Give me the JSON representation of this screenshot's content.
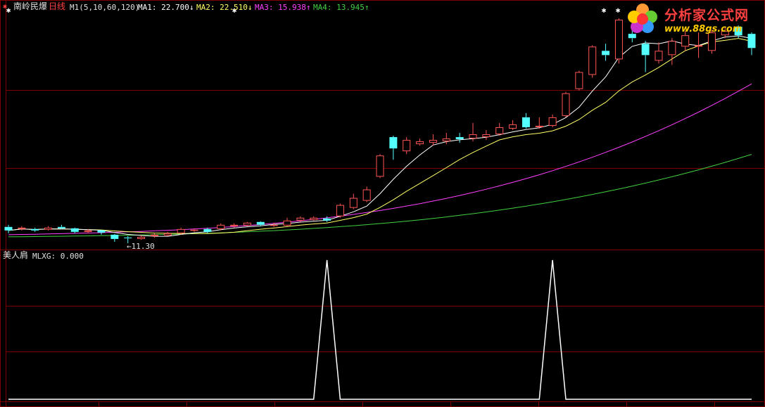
{
  "header": {
    "stock_name": "南岭民爆",
    "period": "日线",
    "indicator_params": "M1(5,10,60,120)",
    "ma1": "MA1: 22.700↓",
    "ma2": "MA2: 22.510↓",
    "ma3": "MA3: 15.938↑",
    "ma4": "MA4: 13.945↑"
  },
  "sub_panel": {
    "name": "美人肩",
    "value": "MLXG: 0.000"
  },
  "annotation_low": "←11.30",
  "watermark": {
    "title": "分析家公式网",
    "url": "www.88gs.com"
  },
  "colors": {
    "background": "#000000",
    "grid": "#800000",
    "up_candle": "#ff5555",
    "down_candle": "#54ffff",
    "ma1": "#ffffff",
    "ma2": "#ffff66",
    "ma3": "#ff40ff",
    "ma4": "#40d040",
    "signal": "#ffffff"
  },
  "chart_data": [
    {
      "type": "candlestick",
      "title": "南岭民爆 日线",
      "ylim": [
        11,
        27.5
      ],
      "candles": [
        [
          12.45,
          12.2,
          12.6,
          12.0
        ],
        [
          12.3,
          12.4,
          12.5,
          12.2
        ],
        [
          12.3,
          12.2,
          12.4,
          12.1
        ],
        [
          12.25,
          12.4,
          12.5,
          12.2
        ],
        [
          12.45,
          12.35,
          12.6,
          12.3
        ],
        [
          12.35,
          12.1,
          12.4,
          12.0
        ],
        [
          12.1,
          12.2,
          12.3,
          12.0
        ],
        [
          12.2,
          12.05,
          12.25,
          11.9
        ],
        [
          11.9,
          11.6,
          11.95,
          11.4
        ],
        [
          11.7,
          11.65,
          11.8,
          11.3
        ],
        [
          11.6,
          11.75,
          11.85,
          11.55
        ],
        [
          11.8,
          11.9,
          12.0,
          11.7
        ],
        [
          11.85,
          12.0,
          12.1,
          11.8
        ],
        [
          12.0,
          12.3,
          12.4,
          11.9
        ],
        [
          12.2,
          12.25,
          12.35,
          12.1
        ],
        [
          12.3,
          12.1,
          12.4,
          12.0
        ],
        [
          12.3,
          12.6,
          12.7,
          12.2
        ],
        [
          12.5,
          12.6,
          12.7,
          12.4
        ],
        [
          12.55,
          12.75,
          12.8,
          12.5
        ],
        [
          12.8,
          12.6,
          12.85,
          12.5
        ],
        [
          12.55,
          12.6,
          12.75,
          12.45
        ],
        [
          12.55,
          12.9,
          13.1,
          12.5
        ],
        [
          12.9,
          13.1,
          13.2,
          12.8
        ],
        [
          12.95,
          13.1,
          13.2,
          12.9
        ],
        [
          13.05,
          12.9,
          13.2,
          12.8
        ],
        [
          13.2,
          14.0,
          14.1,
          13.1
        ],
        [
          13.8,
          14.5,
          14.8,
          13.7
        ],
        [
          14.3,
          15.1,
          15.3,
          14.2
        ],
        [
          16.0,
          17.5,
          17.6,
          15.9
        ],
        [
          18.8,
          18.0,
          18.9,
          17.2
        ],
        [
          17.8,
          18.6,
          18.8,
          17.6
        ],
        [
          18.3,
          18.5,
          18.7,
          18.2
        ],
        [
          18.4,
          18.6,
          19.0,
          18.2
        ],
        [
          18.5,
          18.7,
          19.1,
          18.3
        ],
        [
          18.8,
          18.65,
          19.1,
          18.4
        ],
        [
          18.7,
          19.0,
          19.8,
          18.5
        ],
        [
          18.8,
          19.0,
          19.3,
          18.6
        ],
        [
          19.0,
          19.5,
          19.8,
          18.9
        ],
        [
          19.4,
          19.7,
          20.0,
          19.3
        ],
        [
          20.2,
          19.5,
          20.5,
          19.4
        ],
        [
          19.5,
          19.6,
          20.2,
          19.4
        ],
        [
          19.6,
          20.2,
          20.4,
          19.5
        ],
        [
          20.3,
          21.9,
          22.0,
          20.2
        ],
        [
          22.2,
          23.4,
          23.5,
          22.1
        ],
        [
          23.2,
          25.2,
          25.3,
          23.0
        ],
        [
          24.9,
          24.6,
          25.4,
          24.2
        ],
        [
          24.3,
          27.1,
          27.2,
          24.0
        ],
        [
          26.1,
          25.8,
          26.4,
          25.5
        ],
        [
          25.4,
          24.6,
          25.6,
          23.4
        ],
        [
          24.2,
          24.9,
          25.5,
          24.0
        ],
        [
          24.6,
          25.6,
          25.8,
          23.9
        ],
        [
          25.2,
          26.0,
          26.3,
          24.9
        ],
        [
          25.2,
          25.3,
          26.2,
          24.4
        ],
        [
          24.9,
          26.2,
          26.4,
          24.7
        ],
        [
          26.0,
          26.3,
          26.6,
          25.8
        ],
        [
          26.6,
          26.0,
          26.7,
          25.8
        ],
        [
          26.1,
          25.1,
          26.2,
          24.6
        ]
      ]
    },
    {
      "type": "line",
      "title": "美人肩",
      "series": [
        {
          "name": "MLXG",
          "values": [
            0,
            0,
            0,
            0,
            0,
            0,
            0,
            0,
            0,
            0,
            0,
            0,
            0,
            0,
            0,
            0,
            0,
            0,
            0,
            0,
            0,
            0,
            0,
            0,
            1,
            0,
            0,
            0,
            0,
            0,
            0,
            0,
            0,
            0,
            0,
            0,
            0,
            0,
            0,
            0,
            0,
            1,
            0,
            0,
            0,
            0,
            0,
            0,
            0,
            0,
            0,
            0,
            0,
            0,
            0,
            0,
            0
          ]
        }
      ],
      "ylim": [
        0,
        1
      ]
    }
  ]
}
